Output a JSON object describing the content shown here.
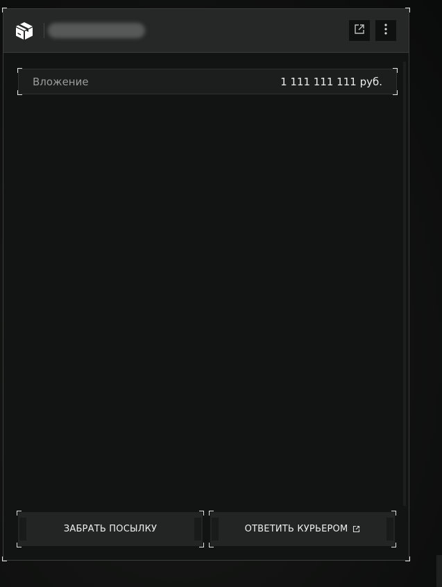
{
  "header": {
    "title": "",
    "open_icon": "external-link-icon",
    "menu_icon": "more-vertical-icon",
    "logo_icon": "package-box-icon"
  },
  "info": {
    "label": "Вложение",
    "value": "1 111 111 111 руб."
  },
  "actions": {
    "take_label": "ЗАБРАТЬ ПОСЫЛКУ",
    "reply_label": "ОТВЕТИТЬ КУРЬЕРОМ"
  },
  "colors": {
    "panel_bg": "#121313",
    "header_bg": "#262727",
    "text": "#ededed",
    "muted": "#9a9c9c",
    "corner": "#e6e6e6"
  }
}
